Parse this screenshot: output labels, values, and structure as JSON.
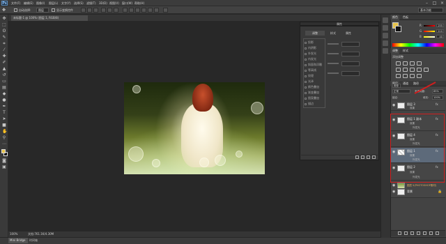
{
  "app": {
    "logo": "Ps"
  },
  "menubar": {
    "items": [
      "文件(F)",
      "编辑(E)",
      "图像(I)",
      "图层(L)",
      "文字(Y)",
      "选择(S)",
      "滤镜(T)",
      "3D(D)",
      "视图(V)",
      "窗口(W)",
      "帮助(H)"
    ]
  },
  "optionsbar": {
    "auto_select_label": "自动选择:",
    "auto_select_value": "图层",
    "show_transform_label": "显示变换控件",
    "workspace": "基本功能"
  },
  "document": {
    "tab_title": "未标题-1 @ 100% (图层 1, RGB/8)"
  },
  "status": {
    "zoom": "100%",
    "doc_info": "文档:761.1K/4.30M"
  },
  "bottom_tabs": {
    "mini_bridge": "Mini Bridge",
    "timeline": "时间轴"
  },
  "dialog": {
    "header": "属性",
    "tab_adjust": "调整",
    "tab_styles": "样式",
    "tab_props": "属性",
    "rows": [
      "投影",
      "内阴影",
      "外发光",
      "内发光",
      "斜面和浮雕",
      "等高线",
      "纹理",
      "光泽",
      "颜色叠加",
      "渐变叠加",
      "图案叠加",
      "描边"
    ]
  },
  "color_panel": {
    "tab_color": "颜色",
    "tab_swatches": "色板",
    "r_label": "R",
    "g_label": "G",
    "b_label": "B",
    "r_value": "255",
    "g_value": "210",
    "b_value": "40"
  },
  "adjustments_panel": {
    "tab_adjustments": "调整",
    "tab_styles": "样式",
    "add_label": "添加调整"
  },
  "layers_panel": {
    "tab_layers": "图层",
    "tab_channels": "通道",
    "tab_paths": "路径",
    "kind_label": "类型",
    "blend_mode": "正常",
    "opacity_label": "不透明度:",
    "opacity_value": "85%",
    "fill_label": "填充:",
    "fill_value": "100%",
    "lock_label": "锁定:",
    "layers": [
      {
        "name": "图层 3",
        "sub1": "效果",
        "sub2": "外发光"
      },
      {
        "name": "图层 1 副本",
        "sub1": "效果",
        "sub2": "外发光"
      },
      {
        "name": "图层 4",
        "sub1": "效果",
        "sub2": "外发光"
      },
      {
        "name": "图层 1",
        "sub1": "效果",
        "sub2": "外发光"
      },
      {
        "name": "图层 2",
        "sub1": "效果",
        "sub2": "外发光"
      },
      {
        "name": "图层 5(PHOTOSHOP素材)",
        "sub1": "",
        "sub2": ""
      },
      {
        "name": "背景",
        "sub1": "",
        "sub2": ""
      }
    ],
    "fx": "fx"
  },
  "colors": {
    "highlight": "#d21e1e",
    "foreground": "#e6c24a",
    "background": "#111111"
  }
}
